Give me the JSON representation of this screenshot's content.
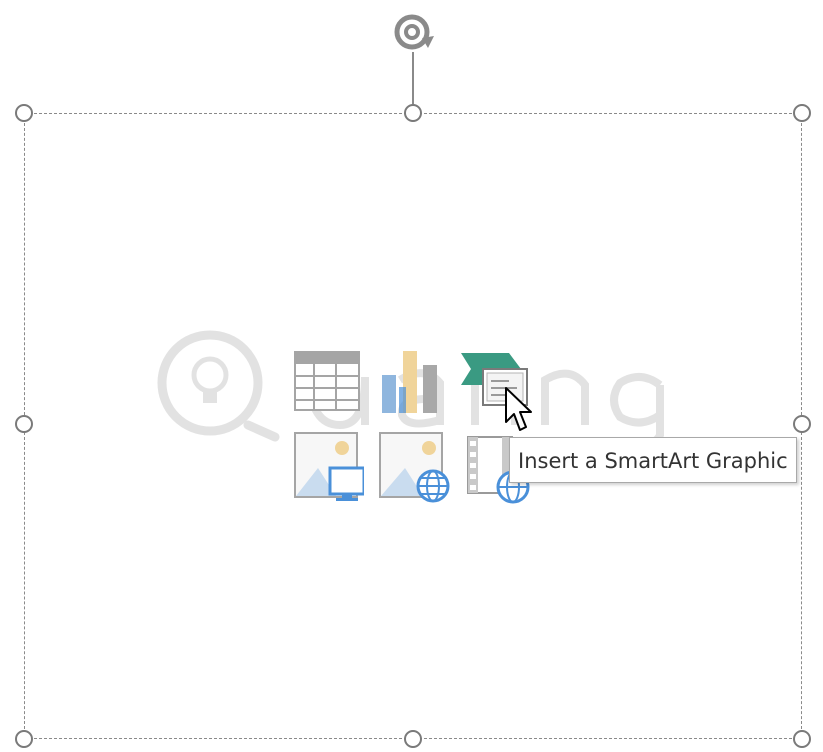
{
  "placeholder": {
    "content_icons": [
      {
        "id": "table",
        "icon": "table-icon"
      },
      {
        "id": "chart",
        "icon": "chart-icon"
      },
      {
        "id": "smartart",
        "icon": "smartart-icon"
      },
      {
        "id": "pictures",
        "icon": "pictures-icon"
      },
      {
        "id": "online-pictures",
        "icon": "online-pictures-icon"
      },
      {
        "id": "video",
        "icon": "video-icon"
      }
    ]
  },
  "tooltip": {
    "text": "Insert a SmartArt Graphic"
  },
  "colors": {
    "frame": "#8a8a8a",
    "handle": "#7a7a7a",
    "smartart_accent": "#3a9a82",
    "chart_tan": "#f0d49a",
    "chart_blue": "#8fb6de",
    "picture_blue": "#4a90d9"
  }
}
